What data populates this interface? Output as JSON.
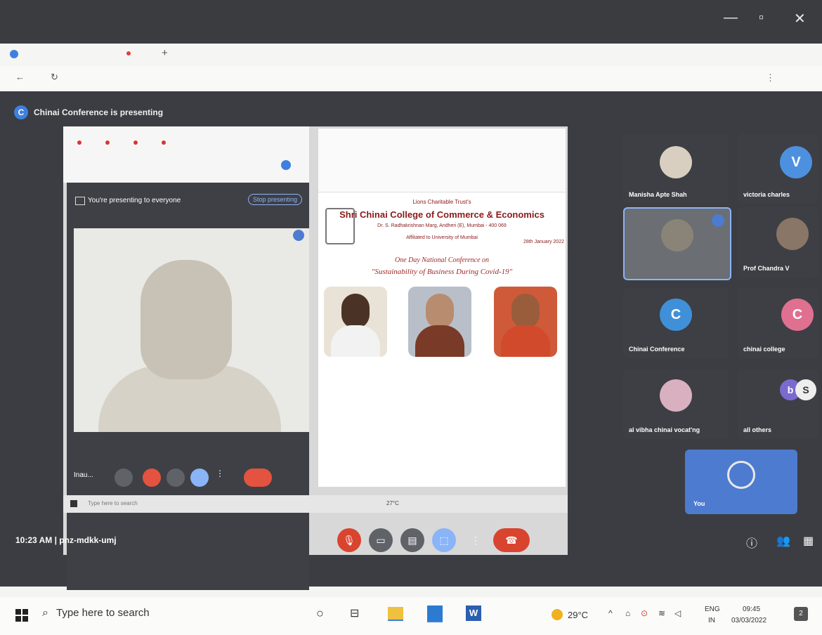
{
  "meet": {
    "presenting_banner": "Chinai Conference is presenting",
    "presenting_avatar_letter": "C",
    "clock": "10:23 AM",
    "separator": "|",
    "meeting_code": "pnz-mdkk-umj",
    "participants": [
      {
        "name": "Manisha Apte Shah"
      },
      {
        "name": "victoria charles",
        "letter": "V"
      },
      {
        "name": "Prof Chandra V"
      },
      {
        "name": "Chinai Conference",
        "letter": "C"
      },
      {
        "name": "chinai college",
        "letter": "C"
      },
      {
        "name": "al vibha chinai vocat'ng"
      },
      {
        "name": "all others"
      }
    ],
    "self_label": "You"
  },
  "shared_screen": {
    "presenting_to_everyone": "You're presenting to everyone",
    "stop_presenting": "Stop presenting",
    "inner_name": "Inau...",
    "inner_search": "Type here to search",
    "inner_temp": "27°C"
  },
  "document": {
    "trust": "Lions Charitable Trust's",
    "college": "Shri Chinai College of Commerce & Economics",
    "address": "Dr. S. Radhakrishnan Marg, Andheri (E), Mumbai - 400 069",
    "affiliation": "Affiliated to University of Mumbai",
    "date": "28th January 2022",
    "conference": "One Day National Conference on",
    "theme": "\"Sustainability of Business During Covid-19\""
  },
  "taskbar": {
    "search_placeholder": "Type here to search",
    "temperature": "29°C",
    "lang1": "ENG",
    "lang2": "IN",
    "time": "09:45",
    "date": "03/03/2022",
    "notification_count": "2"
  }
}
